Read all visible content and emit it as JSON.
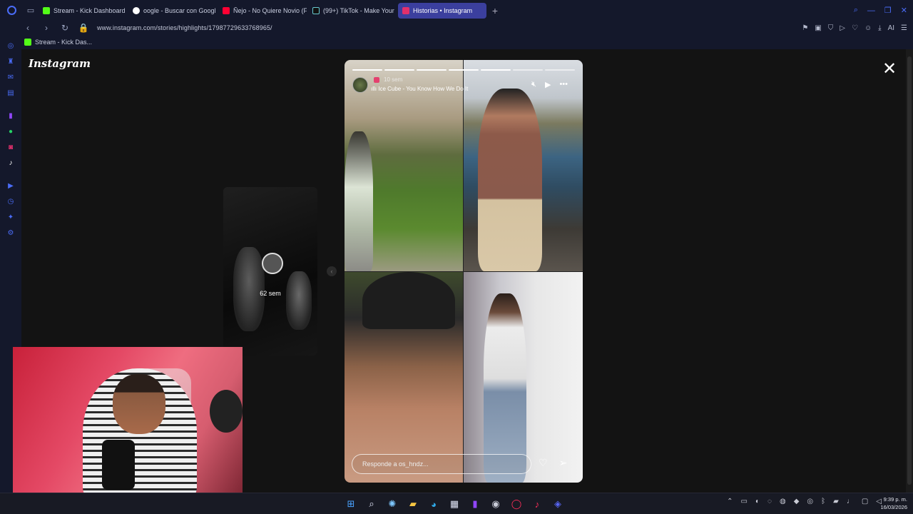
{
  "browser": {
    "tabs": [
      {
        "title": "Stream - Kick Dashboard",
        "color": "#53fc18",
        "active": false
      },
      {
        "title": "oogle - Buscar con Googl",
        "color": "#4285f4",
        "active": false
      },
      {
        "title": "Ñejo - No Quiere Novio (F",
        "color": "#ff0033",
        "active": false
      },
      {
        "title": "(99+) TikTok - Make Your",
        "color": "#ffffff",
        "active": false
      },
      {
        "title": "Historias • Instagram",
        "color": "#e1306c",
        "active": true
      }
    ],
    "new_tab": "+",
    "url": "www.instagram.com/stories/highlights/17987729633768965/",
    "bookmark": "Stream - Kick Das..."
  },
  "page": {
    "logo": "Instagram",
    "close": "✕",
    "prev_story_label": "62 sem",
    "story": {
      "time": "10 sem",
      "song": "Ice Cube - You Know How We Do It",
      "reply_placeholder": "Responde a os_hndz...",
      "progress_total": 7,
      "progress_done": 5
    }
  },
  "taskbar": {
    "time": "9:39 p. m.",
    "date": "16/03/2026"
  }
}
